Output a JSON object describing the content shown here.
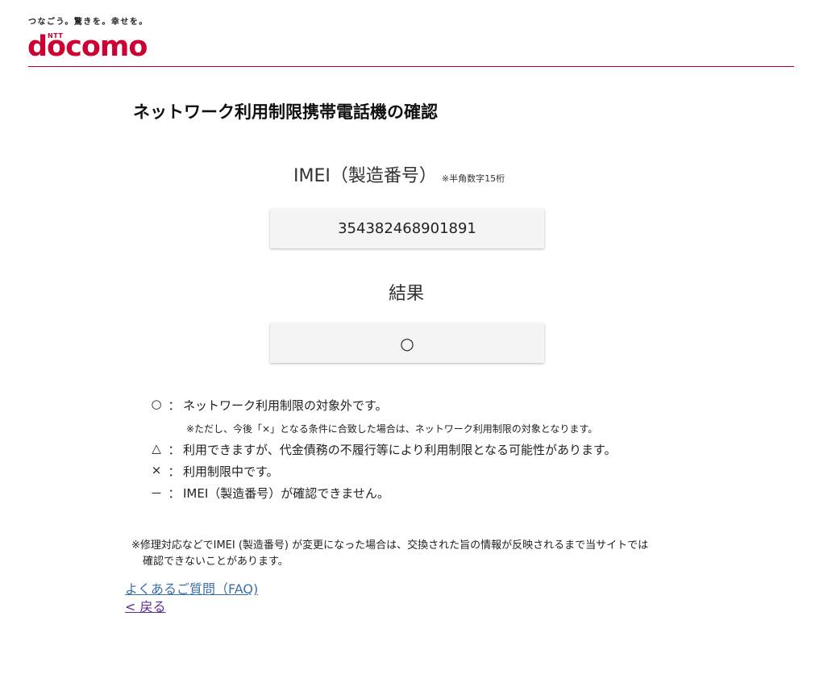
{
  "header": {
    "tagline": "つなごう。驚きを。幸せを。",
    "logo_small": "NTT",
    "logo_text": "docomo"
  },
  "page": {
    "title": "ネットワーク利用制限携帯電話機の確認"
  },
  "imei": {
    "label": "IMEI（製造番号）",
    "note": "※半角数字15桁",
    "value": "354382468901891"
  },
  "result": {
    "label": "結果",
    "value": "○"
  },
  "legend": {
    "colon": "：",
    "rows": [
      {
        "symbol": "○",
        "text": "ネットワーク利用制限の対象外です。"
      },
      {
        "symbol": "△",
        "text": "利用できますが、代金債務の不履行等により利用制限となる可能性があります。"
      },
      {
        "symbol": "×",
        "text": "利用制限中です。"
      },
      {
        "symbol": "－",
        "text": "IMEI（製造番号）が確認できません。"
      }
    ],
    "sub_note": "※ただし、今後「×」となる条件に合致した場合は、ネットワーク利用制限の対象となります。"
  },
  "footnote": {
    "line1": "※修理対応などでIMEI (製造番号) が変更になった場合は、交換された旨の情報が反映されるまで当サイトでは",
    "line2": "確認できないことがあります。"
  },
  "links": {
    "faq": "よくあるご質問（FAQ)",
    "back": "< 戻る"
  },
  "colors": {
    "brand": "#cc0033",
    "link": "#3b6fa8",
    "visited_link": "#5b2c8f"
  }
}
